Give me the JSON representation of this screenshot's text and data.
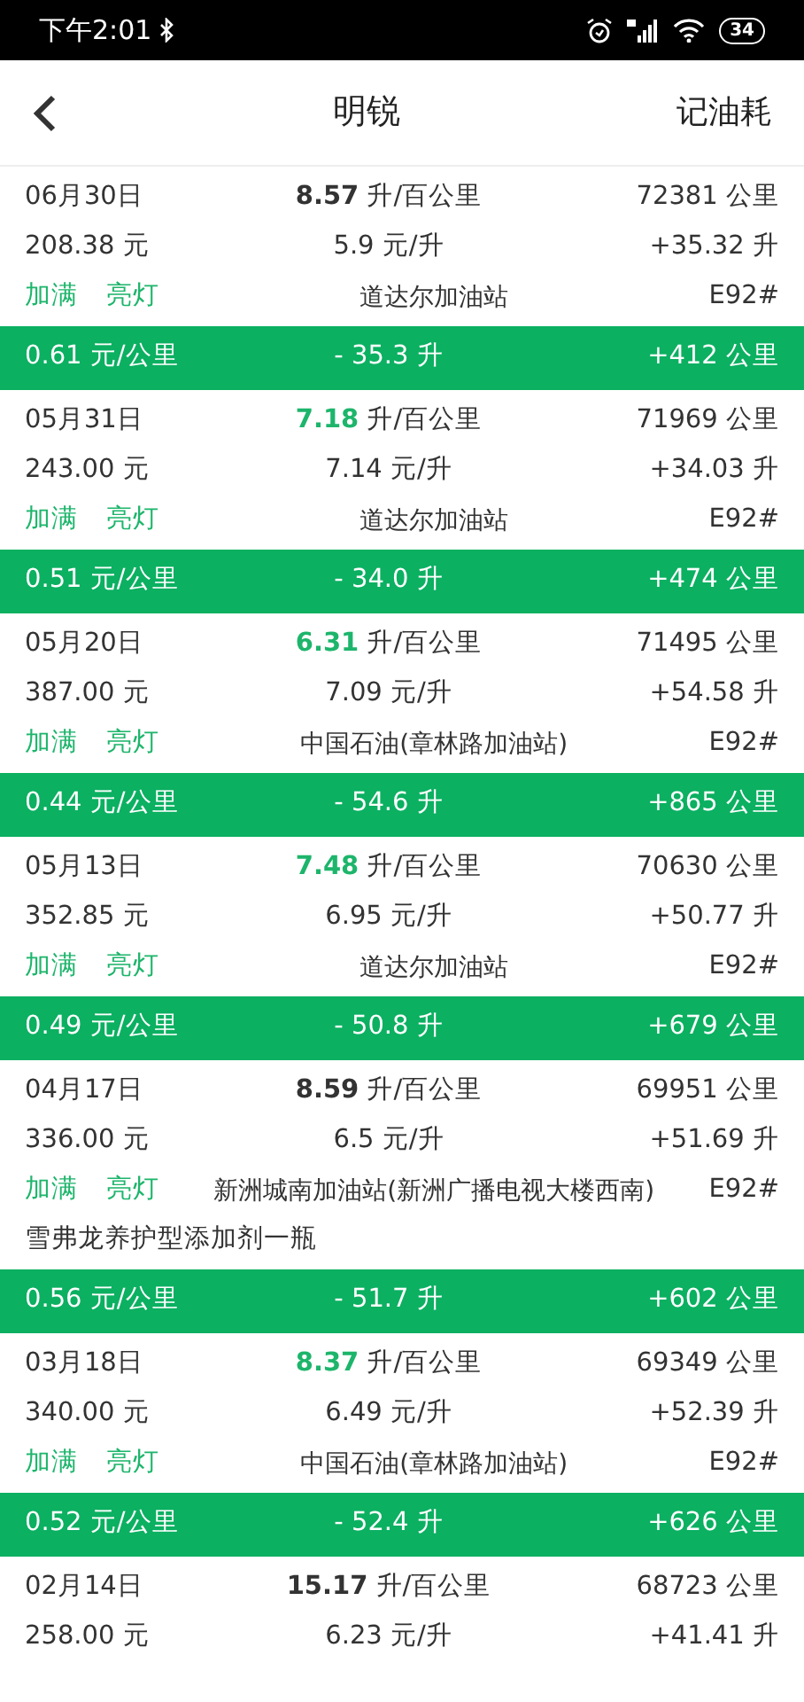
{
  "status_bar": {
    "time": "下午2:01",
    "battery": "34"
  },
  "header": {
    "title": "明锐",
    "action": "记油耗"
  },
  "entries": [
    {
      "date": "06月30日",
      "consumption": "8.57",
      "consumption_unit": "升/百公里",
      "good": false,
      "odometer": "72381 公里",
      "cost": "208.38 元",
      "price": "5.9 元/升",
      "added": "+35.32 升",
      "tags": [
        "加满",
        "亮灯"
      ],
      "station": "道达尔加油站",
      "grade": "E92#",
      "summary": {
        "cost_per_km": "0.61 元/公里",
        "fuel_diff": "- 35.3 升",
        "distance": "+412 公里"
      }
    },
    {
      "date": "05月31日",
      "consumption": "7.18",
      "consumption_unit": "升/百公里",
      "good": true,
      "odometer": "71969 公里",
      "cost": "243.00 元",
      "price": "7.14 元/升",
      "added": "+34.03 升",
      "tags": [
        "加满",
        "亮灯"
      ],
      "station": "道达尔加油站",
      "grade": "E92#",
      "summary": {
        "cost_per_km": "0.51 元/公里",
        "fuel_diff": "- 34.0 升",
        "distance": "+474 公里"
      }
    },
    {
      "date": "05月20日",
      "consumption": "6.31",
      "consumption_unit": "升/百公里",
      "good": true,
      "odometer": "71495 公里",
      "cost": "387.00 元",
      "price": "7.09 元/升",
      "added": "+54.58 升",
      "tags": [
        "加满",
        "亮灯"
      ],
      "station": "中国石油(章林路加油站)",
      "grade": "E92#",
      "summary": {
        "cost_per_km": "0.44 元/公里",
        "fuel_diff": "- 54.6 升",
        "distance": "+865 公里"
      }
    },
    {
      "date": "05月13日",
      "consumption": "7.48",
      "consumption_unit": "升/百公里",
      "good": true,
      "odometer": "70630 公里",
      "cost": "352.85 元",
      "price": "6.95 元/升",
      "added": "+50.77 升",
      "tags": [
        "加满",
        "亮灯"
      ],
      "station": "道达尔加油站",
      "grade": "E92#",
      "summary": {
        "cost_per_km": "0.49 元/公里",
        "fuel_diff": "- 50.8 升",
        "distance": "+679 公里"
      }
    },
    {
      "date": "04月17日",
      "consumption": "8.59",
      "consumption_unit": "升/百公里",
      "good": false,
      "odometer": "69951 公里",
      "cost": "336.00 元",
      "price": "6.5 元/升",
      "added": "+51.69 升",
      "tags": [
        "加满",
        "亮灯"
      ],
      "station": "新洲城南加油站(新洲广播电视大楼西南)",
      "grade": "E92#",
      "note": "雪弗龙养护型添加剂一瓶",
      "summary": {
        "cost_per_km": "0.56 元/公里",
        "fuel_diff": "- 51.7 升",
        "distance": "+602 公里"
      }
    },
    {
      "date": "03月18日",
      "consumption": "8.37",
      "consumption_unit": "升/百公里",
      "good": true,
      "odometer": "69349 公里",
      "cost": "340.00 元",
      "price": "6.49 元/升",
      "added": "+52.39 升",
      "tags": [
        "加满",
        "亮灯"
      ],
      "station": "中国石油(章林路加油站)",
      "grade": "E92#",
      "summary": {
        "cost_per_km": "0.52 元/公里",
        "fuel_diff": "- 52.4 升",
        "distance": "+626 公里"
      }
    },
    {
      "date": "02月14日",
      "consumption": "15.17",
      "consumption_unit": "升/百公里",
      "good": false,
      "odometer": "68723 公里",
      "cost": "258.00 元",
      "price": "6.23 元/升",
      "added": "+41.41 升"
    }
  ]
}
